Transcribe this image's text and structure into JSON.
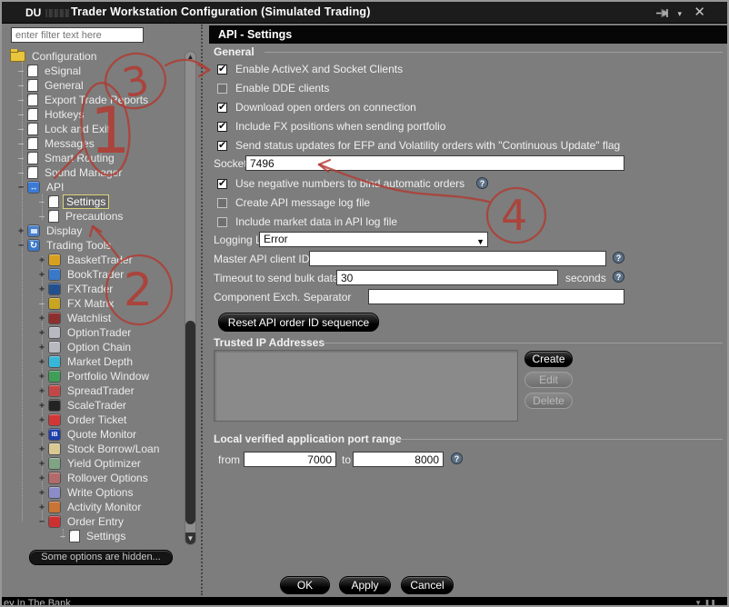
{
  "window": {
    "title_prefix": "DU",
    "title": "Trader Workstation Configuration (Simulated Trading)",
    "pin_icon": "pin-icon",
    "close_icon": "close-icon",
    "status_left": "ey In The Bank"
  },
  "sidebar": {
    "filter_placeholder": "enter filter text here",
    "hidden_note": "Some options are hidden...",
    "tree": [
      {
        "label": "Configuration",
        "level": 0,
        "expander": "root",
        "icon": "folder",
        "selected": false
      },
      {
        "label": "eSignal",
        "level": 1,
        "expander": "none",
        "icon": "page",
        "selected": false
      },
      {
        "label": "General",
        "level": 1,
        "expander": "none",
        "icon": "page",
        "selected": false
      },
      {
        "label": "Export Trade Reports",
        "level": 1,
        "expander": "none",
        "icon": "page",
        "selected": false
      },
      {
        "label": "Hotkeys",
        "level": 1,
        "expander": "none",
        "icon": "page",
        "selected": false
      },
      {
        "label": "Lock and Exit",
        "level": 1,
        "expander": "none",
        "icon": "page",
        "selected": false
      },
      {
        "label": "Messages",
        "level": 1,
        "expander": "none",
        "icon": "page",
        "selected": false
      },
      {
        "label": "Smart Routing",
        "level": 1,
        "expander": "none",
        "icon": "page",
        "selected": false
      },
      {
        "label": "Sound Manager",
        "level": 1,
        "expander": "none",
        "icon": "page",
        "selected": false
      },
      {
        "label": "API",
        "level": 1,
        "expander": "minus",
        "icon": "api",
        "color": "#3a7ad8",
        "selected": false
      },
      {
        "label": "Settings",
        "level": 2,
        "expander": "none",
        "icon": "page",
        "selected": true
      },
      {
        "label": "Precautions",
        "level": 2,
        "expander": "none",
        "icon": "page",
        "selected": false
      },
      {
        "label": "Display",
        "level": 1,
        "expander": "plus",
        "icon": "display",
        "color": "#4a80c8",
        "selected": false
      },
      {
        "label": "Trading Tools",
        "level": 1,
        "expander": "minus",
        "icon": "tools",
        "color": "#3a78c8",
        "selected": false
      },
      {
        "label": "BasketTrader",
        "level": 2,
        "expander": "plus",
        "icon": "basket",
        "color": "#d8a020",
        "selected": false
      },
      {
        "label": "BookTrader",
        "level": 2,
        "expander": "plus",
        "icon": "book",
        "color": "#3a78c8",
        "selected": false
      },
      {
        "label": "FXTrader",
        "level": 2,
        "expander": "plus",
        "icon": "fxtrader",
        "color": "#22508e",
        "selected": false
      },
      {
        "label": "FX Matrix",
        "level": 2,
        "expander": "none",
        "icon": "fxmatrix",
        "color": "#c8a423",
        "selected": false
      },
      {
        "label": "Watchlist",
        "level": 2,
        "expander": "plus",
        "icon": "watchlist",
        "color": "#8e2f2f",
        "selected": false
      },
      {
        "label": "OptionTrader",
        "level": 2,
        "expander": "plus",
        "icon": "optiontrader",
        "color": "#b8b8c0",
        "selected": false
      },
      {
        "label": "Option Chain",
        "level": 2,
        "expander": "plus",
        "icon": "optionchain",
        "color": "#b8b8c0",
        "selected": false
      },
      {
        "label": "Market Depth",
        "level": 2,
        "expander": "plus",
        "icon": "marketdepth",
        "color": "#38b6d8",
        "selected": false
      },
      {
        "label": "Portfolio Window",
        "level": 2,
        "expander": "plus",
        "icon": "portfolio",
        "color": "#3f9e58",
        "selected": false
      },
      {
        "label": "SpreadTrader",
        "level": 2,
        "expander": "plus",
        "icon": "spreadtrader",
        "color": "#c24848",
        "selected": false
      },
      {
        "label": "ScaleTrader",
        "level": 2,
        "expander": "plus",
        "icon": "scaletrader",
        "color": "#232323",
        "selected": false
      },
      {
        "label": "Order Ticket",
        "level": 2,
        "expander": "plus",
        "icon": "orderticket",
        "color": "#d23636",
        "selected": false
      },
      {
        "label": "Quote Monitor",
        "level": 2,
        "expander": "plus",
        "icon": "ib",
        "color": "#1d3fae",
        "selected": false
      },
      {
        "label": "Stock Borrow/Loan",
        "level": 2,
        "expander": "plus",
        "icon": "stockborrow",
        "color": "#d9c893",
        "selected": false
      },
      {
        "label": "Yield Optimizer",
        "level": 2,
        "expander": "plus",
        "icon": "yield",
        "color": "#7fa383",
        "selected": false
      },
      {
        "label": "Rollover Options",
        "level": 2,
        "expander": "plus",
        "icon": "rollover",
        "color": "#b26a6a",
        "selected": false
      },
      {
        "label": "Write Options",
        "level": 2,
        "expander": "plus",
        "icon": "writeoptions",
        "color": "#8c8cc8",
        "selected": false
      },
      {
        "label": "Activity Monitor",
        "level": 2,
        "expander": "plus",
        "icon": "activity",
        "color": "#c87434",
        "selected": false
      },
      {
        "label": "Order Entry",
        "level": 2,
        "expander": "minus",
        "icon": "orderentry",
        "color": "#cc3030",
        "selected": false
      },
      {
        "label": "Settings",
        "level": 3,
        "expander": "none",
        "icon": "page",
        "selected": false
      }
    ]
  },
  "panel": {
    "header": "API - Settings",
    "general_label": "General",
    "checkboxes": [
      {
        "label": "Enable ActiveX and Socket Clients",
        "checked": true
      },
      {
        "label": "Enable DDE clients",
        "checked": false
      },
      {
        "label": "Download open orders on connection",
        "checked": true
      },
      {
        "label": "Include FX positions when sending portfolio",
        "checked": true
      },
      {
        "label": "Send status updates for EFP and Volatility orders with \"Continuous Update\" flag",
        "checked": true
      },
      {
        "label": "Use negative numbers to bind automatic orders",
        "checked": true,
        "help": true
      },
      {
        "label": "Create API message log file",
        "checked": false
      },
      {
        "label": "Include market data in API log file",
        "checked": false
      }
    ],
    "socket_port": {
      "label": "Socket port",
      "value": "7496"
    },
    "logging": {
      "label": "Logging Level",
      "value": "Error"
    },
    "master": {
      "label": "Master API client ID",
      "value": ""
    },
    "timeout": {
      "label": "Timeout to send bulk data to API",
      "value": "30",
      "suffix": "seconds"
    },
    "component": {
      "label": "Component Exch. Separator",
      "value": ""
    },
    "reset_label": "Reset API order ID sequence",
    "trusted": {
      "label": "Trusted IP Addresses",
      "create": "Create",
      "edit": "Edit",
      "delete": "Delete"
    },
    "port_range": {
      "label": "Local verified application port range",
      "from_label": "from",
      "from_value": "7000",
      "to_label": "to",
      "to_value": "8000"
    },
    "footer": {
      "ok": "OK",
      "apply": "Apply",
      "cancel": "Cancel"
    }
  },
  "annotations": {
    "one": "1",
    "two": "2",
    "three": "3",
    "four": "4"
  }
}
